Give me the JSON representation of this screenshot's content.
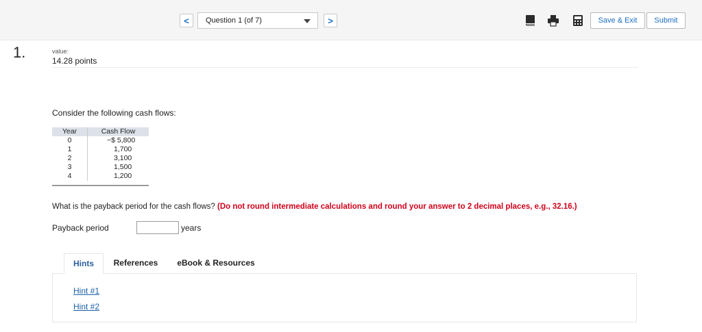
{
  "header": {
    "prev_label": "<",
    "next_label": ">",
    "question_select": "Question 1 (of 7)",
    "save_exit_label": "Save & Exit",
    "submit_label": "Submit"
  },
  "question": {
    "number": "1.",
    "value_label": "value:",
    "points": "14.28 points",
    "intro": "Consider the following cash flows:",
    "table": {
      "headers": [
        "Year",
        "Cash Flow"
      ],
      "rows": [
        [
          "0",
          "−$ 5,800"
        ],
        [
          "1",
          "1,700"
        ],
        [
          "2",
          "3,100"
        ],
        [
          "3",
          "1,500"
        ],
        [
          "4",
          "1,200"
        ]
      ]
    },
    "prompt": "What is the payback period for the cash flows? ",
    "instruction": "(Do not round intermediate calculations and round your answer to 2 decimal places, e.g., 32.16.)",
    "answer_label": "Payback period",
    "answer_value": "",
    "answer_unit": "years"
  },
  "tabs": {
    "hints": "Hints",
    "references": "References",
    "ebook": "eBook & Resources",
    "hint_links": [
      "Hint #1",
      "Hint #2"
    ]
  }
}
